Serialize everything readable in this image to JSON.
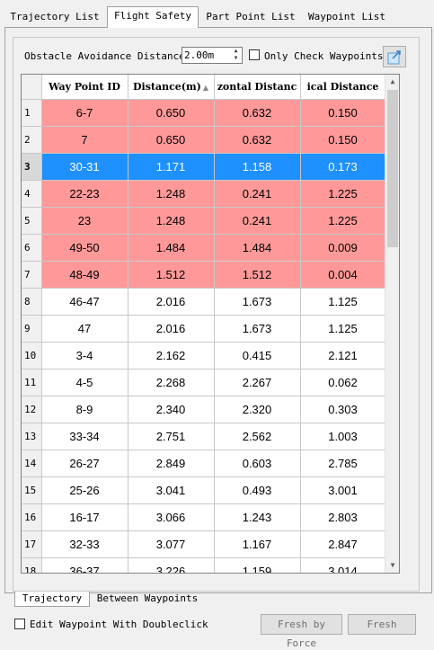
{
  "tabs": [
    {
      "label": "Trajectory List",
      "active": false
    },
    {
      "label": "Flight Safety",
      "active": true
    },
    {
      "label": "Part Point List",
      "active": false
    },
    {
      "label": "Waypoint List",
      "active": false
    }
  ],
  "toolbar": {
    "obstacle_label": "Obstacle Avoidance Distance:",
    "distance_value": "2.00m",
    "only_check_label": "Only Check Waypoints",
    "export_icon": "export-icon"
  },
  "table": {
    "columns": [
      "Way Point ID",
      "Distance(m)",
      "Horizontal Distance",
      "Vertical Distance"
    ],
    "columns_visible": [
      "Way Point ID",
      "Distance(m)",
      "zontal Distanc",
      "ical Distance"
    ],
    "rows": [
      {
        "n": "1",
        "id": "6-7",
        "dist": "0.650",
        "h": "0.632",
        "v": "0.150",
        "state": "warn"
      },
      {
        "n": "2",
        "id": "7",
        "dist": "0.650",
        "h": "0.632",
        "v": "0.150",
        "state": "warn"
      },
      {
        "n": "3",
        "id": "30-31",
        "dist": "1.171",
        "h": "1.158",
        "v": "0.173",
        "state": "sel"
      },
      {
        "n": "4",
        "id": "22-23",
        "dist": "1.248",
        "h": "0.241",
        "v": "1.225",
        "state": "warn"
      },
      {
        "n": "5",
        "id": "23",
        "dist": "1.248",
        "h": "0.241",
        "v": "1.225",
        "state": "warn"
      },
      {
        "n": "6",
        "id": "49-50",
        "dist": "1.484",
        "h": "1.484",
        "v": "0.009",
        "state": "warn"
      },
      {
        "n": "7",
        "id": "48-49",
        "dist": "1.512",
        "h": "1.512",
        "v": "0.004",
        "state": "warn"
      },
      {
        "n": "8",
        "id": "46-47",
        "dist": "2.016",
        "h": "1.673",
        "v": "1.125",
        "state": "normal"
      },
      {
        "n": "9",
        "id": "47",
        "dist": "2.016",
        "h": "1.673",
        "v": "1.125",
        "state": "normal"
      },
      {
        "n": "10",
        "id": "3-4",
        "dist": "2.162",
        "h": "0.415",
        "v": "2.121",
        "state": "normal"
      },
      {
        "n": "11",
        "id": "4-5",
        "dist": "2.268",
        "h": "2.267",
        "v": "0.062",
        "state": "normal"
      },
      {
        "n": "12",
        "id": "8-9",
        "dist": "2.340",
        "h": "2.320",
        "v": "0.303",
        "state": "normal"
      },
      {
        "n": "13",
        "id": "33-34",
        "dist": "2.751",
        "h": "2.562",
        "v": "1.003",
        "state": "normal"
      },
      {
        "n": "14",
        "id": "26-27",
        "dist": "2.849",
        "h": "0.603",
        "v": "2.785",
        "state": "normal"
      },
      {
        "n": "15",
        "id": "25-26",
        "dist": "3.041",
        "h": "0.493",
        "v": "3.001",
        "state": "normal"
      },
      {
        "n": "16",
        "id": "16-17",
        "dist": "3.066",
        "h": "1.243",
        "v": "2.803",
        "state": "normal"
      },
      {
        "n": "17",
        "id": "32-33",
        "dist": "3.077",
        "h": "1.167",
        "v": "2.847",
        "state": "normal"
      },
      {
        "n": "18",
        "id": "36-37",
        "dist": "3.226",
        "h": "1.159",
        "v": "3.014",
        "state": "normal"
      }
    ]
  },
  "bottom_tabs": [
    {
      "label": "Trajectory",
      "active": true
    },
    {
      "label": "Between Waypoints",
      "active": false
    }
  ],
  "footer": {
    "edit_label": "Edit Waypoint With Doubleclick",
    "fresh_by_force": "Fresh by Force",
    "fresh": "Fresh"
  },
  "colors": {
    "warn_row": "#ff9999",
    "selected_row": "#1e90ff"
  }
}
